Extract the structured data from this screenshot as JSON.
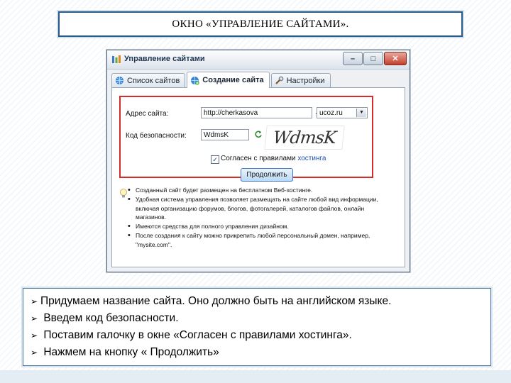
{
  "slide": {
    "title": "ОКНО «УПРАВЛЕНИЕ САЙТАМИ».",
    "bullets": [
      "Придумаем название сайта. Оно должно быть на английском языке.",
      "Введем код безопасности.",
      "Поставим галочку в окне «Согласен с правилами хостинга».",
      "Нажмем на кнопку « Продолжить»"
    ]
  },
  "window": {
    "title": "Управление сайтами",
    "controls": {
      "minimize": "–",
      "maximize": "□",
      "close": "✕"
    },
    "tabs": [
      {
        "label": "Список сайтов",
        "icon": "site-list-icon",
        "active": false
      },
      {
        "label": "Создание сайта",
        "icon": "create-site-icon",
        "active": true
      },
      {
        "label": "Настройки",
        "icon": "settings-icon",
        "active": false
      }
    ],
    "form": {
      "address_label": "Адрес сайта:",
      "address_value": "http://cherkasova",
      "address_dot": ".",
      "domain_value": "ucoz.ru",
      "security_label": "Код безопасности:",
      "security_value": "WdmsK",
      "captcha_text": "WdmsK",
      "agree_text": "Согласен с правилами",
      "agree_link": "хостинга",
      "agree_checked": true,
      "continue_button": "Продолжить"
    },
    "info_items": [
      "Созданный сайт будет размещен на бесплатном Веб-хостинге.",
      "Удобная система управления позволяет размещать на сайте любой вид информации, включая организацию форумов, блогов, фотогалерей, каталогов файлов, онлайн магазинов.",
      "Имеются средства для полного управления дизайном.",
      "После создания к сайту можно прикрепить любой персональный домен, например, \"mysite.com\"."
    ]
  },
  "colors": {
    "accent_blue": "#2c5a86",
    "highlight_red": "#d42b2b",
    "link": "#1c4fb3"
  }
}
